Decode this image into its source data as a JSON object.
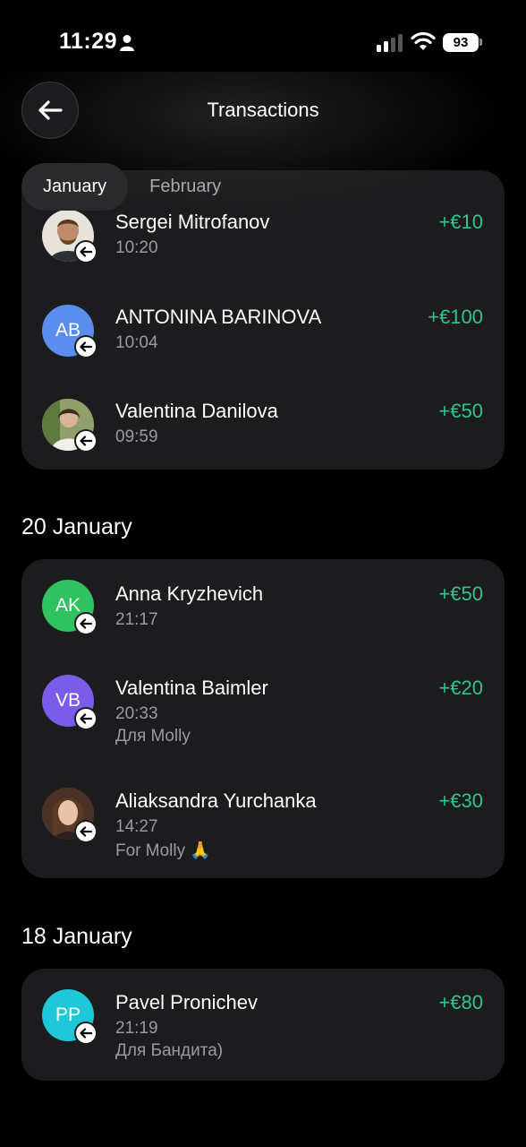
{
  "status_bar": {
    "time": "11:29",
    "battery": "93"
  },
  "header": {
    "title": "Transactions",
    "back_icon": "arrow-left-icon"
  },
  "tabs": [
    {
      "label": "January",
      "active": true
    },
    {
      "label": "February",
      "active": false
    }
  ],
  "groups": [
    {
      "date": "",
      "transactions": [
        {
          "name": "Sergei Mitrofanov",
          "time": "10:20",
          "note": "",
          "amount": "+€10",
          "avatar": "photo"
        },
        {
          "name": "ANTONINA BARINOVA",
          "time": "10:04",
          "note": "",
          "amount": "+€100",
          "initials": "AB",
          "color": "#5b8def"
        },
        {
          "name": "Valentina Danilova",
          "time": "09:59",
          "note": "",
          "amount": "+€50",
          "avatar": "photo"
        }
      ]
    },
    {
      "date": "20 January",
      "transactions": [
        {
          "name": "Anna Kryzhevich",
          "time": "21:17",
          "note": "",
          "amount": "+€50",
          "initials": "AK",
          "color": "#30c160"
        },
        {
          "name": "Valentina Baimler",
          "time": "20:33",
          "note": "Для Molly",
          "amount": "+€20",
          "initials": "VB",
          "color": "#7b5bea"
        },
        {
          "name": "Aliaksandra Yurchanka",
          "time": "14:27",
          "note": "For Molly 🙏",
          "amount": "+€30",
          "avatar": "photo"
        }
      ]
    },
    {
      "date": "18 January",
      "transactions": [
        {
          "name": "Pavel Pronichev",
          "time": "21:19",
          "note": "Для Бандита)",
          "amount": "+€80",
          "initials": "PP",
          "color": "#1fc8d8"
        }
      ]
    }
  ],
  "colors": {
    "background": "#000000",
    "card": "#1c1c1e",
    "positive_amount": "#30c48d",
    "secondary_text": "#9a9aa0"
  }
}
